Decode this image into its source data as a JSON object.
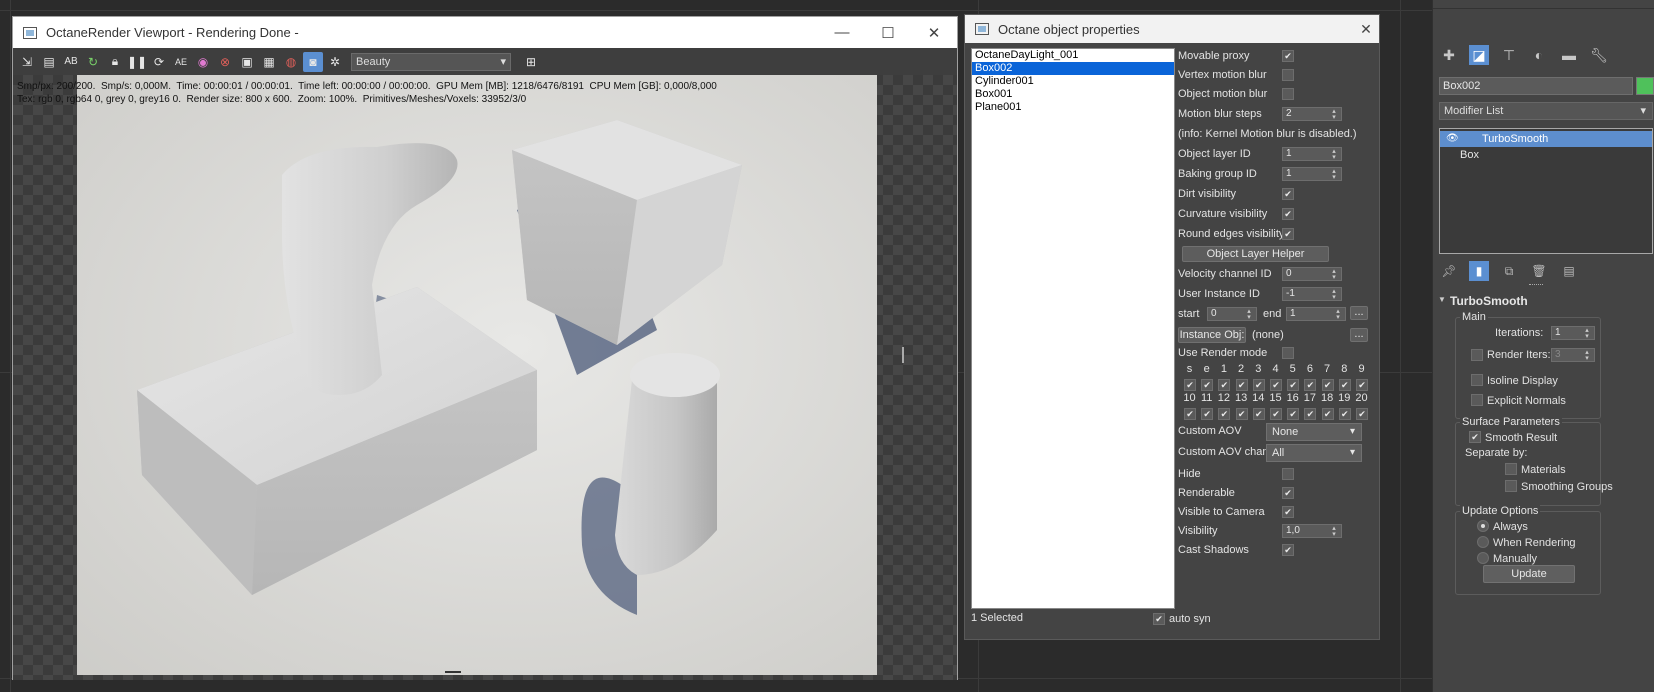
{
  "render_window": {
    "title": "OctaneRender Viewport - Rendering Done -",
    "pass_select": "Beauty",
    "stats_line1": "Smp/px: 200/200.  Smp/s: 0,000M.  Time: 00:00:01 / 00:00:01.  Time left: 00:00:00 / 00:00:00.  GPU Mem [MB]: 1218/6476/8191  CPU Mem [GB]: 0,000/8,000",
    "stats_line2": "Tex: rgb 0, rgb64 0, grey 0, grey16 0.  Render size: 800 x 600.  Zoom: 100%.  Primitives/Meshes/Voxels: 33952/3/0",
    "toolbar_icons": [
      "export-icon",
      "clipboard-icon",
      "ab-compare-icon",
      "restart-icon",
      "lock-icon",
      "pause-icon",
      "refresh-icon",
      "aef-icon",
      "color-wheel-icon",
      "target-icon",
      "save-frame-icon",
      "film-icon",
      "region-icon",
      "camera-icon",
      "settings-icon"
    ],
    "window_buttons": {
      "minimize": "—",
      "maximize": "☐",
      "close": "✕"
    }
  },
  "object_properties": {
    "title": "Octane object properties",
    "close": "✕",
    "objects": [
      "OctaneDayLight_001",
      "Box002",
      "Cylinder001",
      "Box001",
      "Plane001"
    ],
    "selected_object": "Box002",
    "labels": {
      "movable_proxy": "Movable proxy",
      "vertex_motion_blur": "Vertex motion blur",
      "object_motion_blur": "Object motion blur",
      "motion_blur_steps": "Motion blur steps",
      "kernel_info": "(info: Kernel Motion blur is disabled.)",
      "object_layer_id": "Object layer ID",
      "baking_group_id": "Baking group ID",
      "dirt_visibility": "Dirt visibility",
      "curvature_visibility": "Curvature visibility",
      "round_edges_visibility": "Round edges visibility",
      "object_layer_helper": "Object Layer Helper",
      "velocity_channel_id": "Velocity channel ID",
      "user_instance_id": "User Instance ID",
      "start": "start",
      "end": "end",
      "instance_obj": "Instance Obj:",
      "instance_none": "(none)",
      "use_render_mode": "Use Render mode",
      "custom_aov": "Custom AOV",
      "custom_aov_channel": "Custom AOV chan.",
      "hide": "Hide",
      "renderable": "Renderable",
      "visible_to_camera": "Visible to Camera",
      "visibility": "Visibility",
      "cast_shadows": "Cast Shadows",
      "ellipsis": "..."
    },
    "values": {
      "motion_blur_steps": "2",
      "object_layer_id": "1",
      "baking_group_id": "1",
      "velocity_channel_id": "0",
      "user_instance_id": "-1",
      "start": "0",
      "end": "1",
      "custom_aov": "None",
      "custom_aov_channel": "All",
      "visibility": "1,0"
    },
    "checks": {
      "movable_proxy": true,
      "vertex_motion_blur": false,
      "object_motion_blur": false,
      "dirt_visibility": true,
      "curvature_visibility": true,
      "round_edges_visibility": true,
      "use_render_mode": false,
      "hide": false,
      "renderable": true,
      "visible_to_camera": true,
      "cast_shadows": true
    },
    "light_pass_row1": [
      "s",
      "e",
      "1",
      "2",
      "3",
      "4",
      "5",
      "6",
      "7",
      "8",
      "9"
    ],
    "light_pass_row2": [
      "10",
      "11",
      "12",
      "13",
      "14",
      "15",
      "16",
      "17",
      "18",
      "19",
      "20"
    ],
    "footer_selected": "1 Selected",
    "auto_sync": "auto syn"
  },
  "command_panel": {
    "object_name": "Box002",
    "object_color": "#4fc15b",
    "modifier_list": "Modifier List",
    "stack": [
      "TurboSmooth",
      "Box"
    ],
    "rollout": "TurboSmooth",
    "main_group": "Main",
    "iterations_label": "Iterations:",
    "iterations_value": "1",
    "render_iters_label": "Render Iters:",
    "render_iters_value": "3",
    "isoline_display": "Isoline Display",
    "explicit_normals": "Explicit Normals",
    "surface_group": "Surface Parameters",
    "smooth_result": "Smooth Result",
    "separate_by": "Separate by:",
    "materials": "Materials",
    "smoothing_groups": "Smoothing Groups",
    "update_group": "Update Options",
    "always": "Always",
    "when_rendering": "When Rendering",
    "manually": "Manually",
    "update_button": "Update",
    "tabs": [
      "create-icon",
      "modify-icon",
      "hierarchy-icon",
      "motion-icon",
      "display-icon",
      "utilities-icon"
    ]
  },
  "colors": {
    "accent": "#5b8fd1",
    "selection": "#0a64d8",
    "panel": "#444444"
  }
}
